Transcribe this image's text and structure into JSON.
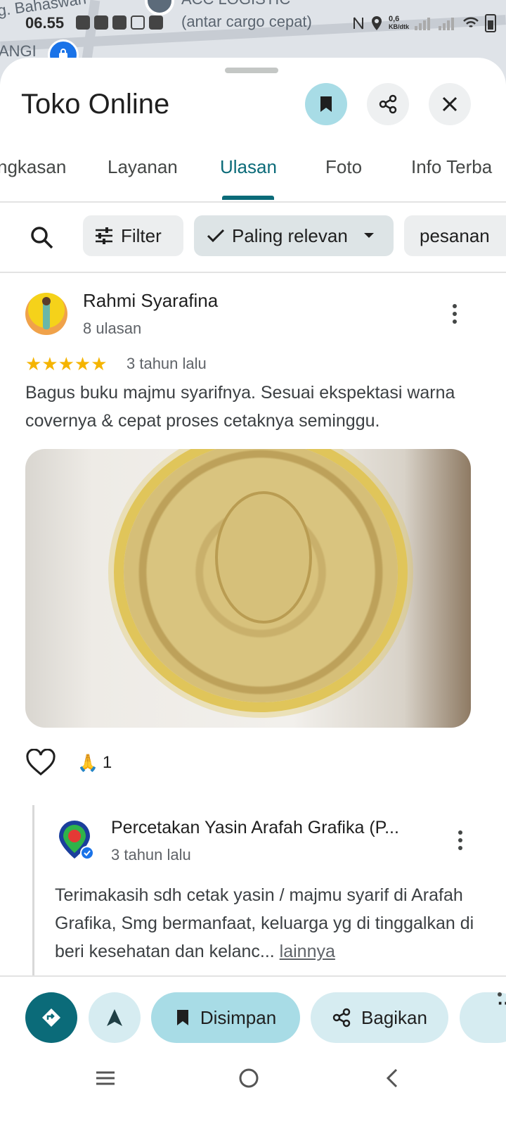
{
  "map": {
    "labels": [
      "g. Bahaswan",
      "ACC LOGISTIC",
      "(antar cargo cepat)",
      "ANGI"
    ]
  },
  "status_bar": {
    "time": "06.55",
    "net_speed": "0,6",
    "net_unit": "KB/dtk"
  },
  "place": {
    "title": "Toko Online"
  },
  "tabs": [
    {
      "label": "ngkasan"
    },
    {
      "label": "Layanan"
    },
    {
      "label": "Ulasan"
    },
    {
      "label": "Foto"
    },
    {
      "label": "Info Terba"
    }
  ],
  "filters": {
    "filter_label": "Filter",
    "sort_label": "Paling relevan",
    "chip_label": "pesanan"
  },
  "review": {
    "author": "Rahmi Syarafina",
    "review_count": "8 ulasan",
    "rating": 5,
    "stars": "★★★★★",
    "time": "3 tahun lalu",
    "text": "Bagus buku majmu syarifnya. Sesuai ekspektasi warna covernya & cepat proses cetaknya seminggu.",
    "reaction_emoji": "🙏",
    "reaction_count": "1"
  },
  "owner_reply": {
    "name": "Percetakan Yasin Arafah Grafika (P...",
    "time": "3 tahun lalu",
    "text": "Terimakasih sdh cetak yasin / majmu syarif di Arafah Grafika, Smg bermanfaat, keluarga yg di tinggalkan di beri kesehatan dan kelanc...",
    "more_label": "lainnya"
  },
  "actions": {
    "saved_label": "Disimpan",
    "share_label": "Bagikan",
    "more_label": "···"
  },
  "colors": {
    "accent": "#0b6b79",
    "saved_bg": "#a8dce6",
    "star": "#f5b400"
  }
}
